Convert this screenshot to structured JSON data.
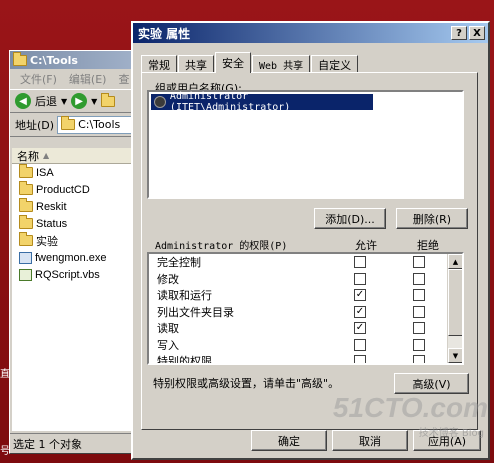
{
  "explorer": {
    "title": "C:\\Tools",
    "menu": [
      "文件(F)",
      "编辑(E)",
      "查"
    ],
    "back_label": "后退",
    "address_label": "地址(D)",
    "address_value": "C:\\Tools",
    "column_header": "名称",
    "files": [
      {
        "name": "ISA",
        "type": "folder"
      },
      {
        "name": "ProductCD",
        "type": "folder"
      },
      {
        "name": "Reskit",
        "type": "folder"
      },
      {
        "name": "Status",
        "type": "folder"
      },
      {
        "name": "实验",
        "type": "folder"
      },
      {
        "name": "fwengmon.exe",
        "type": "exe"
      },
      {
        "name": "RQScript.vbs",
        "type": "script"
      }
    ],
    "status": "选定 1 个对象"
  },
  "dialog": {
    "title": "实验 属性",
    "help_btn": "?",
    "close_btn": "X",
    "tabs": [
      "常规",
      "共享",
      "安全",
      "Web 共享",
      "自定义"
    ],
    "active_tab": "安全",
    "group_label": "组或用户名称(G):",
    "users": [
      "Administrator (ITET\\Administrator)"
    ],
    "add_button": "添加(D)...",
    "remove_button": "删除(R)",
    "perm_label": "Administrator 的权限(P)",
    "allow_header": "允许",
    "deny_header": "拒绝",
    "permissions": [
      {
        "name": "完全控制",
        "allow": false,
        "deny": false
      },
      {
        "name": "修改",
        "allow": false,
        "deny": false
      },
      {
        "name": "读取和运行",
        "allow": true,
        "deny": false
      },
      {
        "name": "列出文件夹目录",
        "allow": true,
        "deny": false
      },
      {
        "name": "读取",
        "allow": true,
        "deny": false
      },
      {
        "name": "写入",
        "allow": false,
        "deny": false
      },
      {
        "name": "特别的权限",
        "allow": false,
        "deny": false
      }
    ],
    "advanced_hint": "特别权限或高级设置，请单击\"高级\"。",
    "advanced_button": "高级(V)",
    "ok_button": "确定",
    "cancel_button": "取消",
    "apply_button": "应用(A)"
  },
  "watermark": {
    "main": "51CTO.com",
    "sub": "技术博客 Blog"
  },
  "desktop": {
    "edge_text_1": "直",
    "edge_text_2": "号"
  }
}
